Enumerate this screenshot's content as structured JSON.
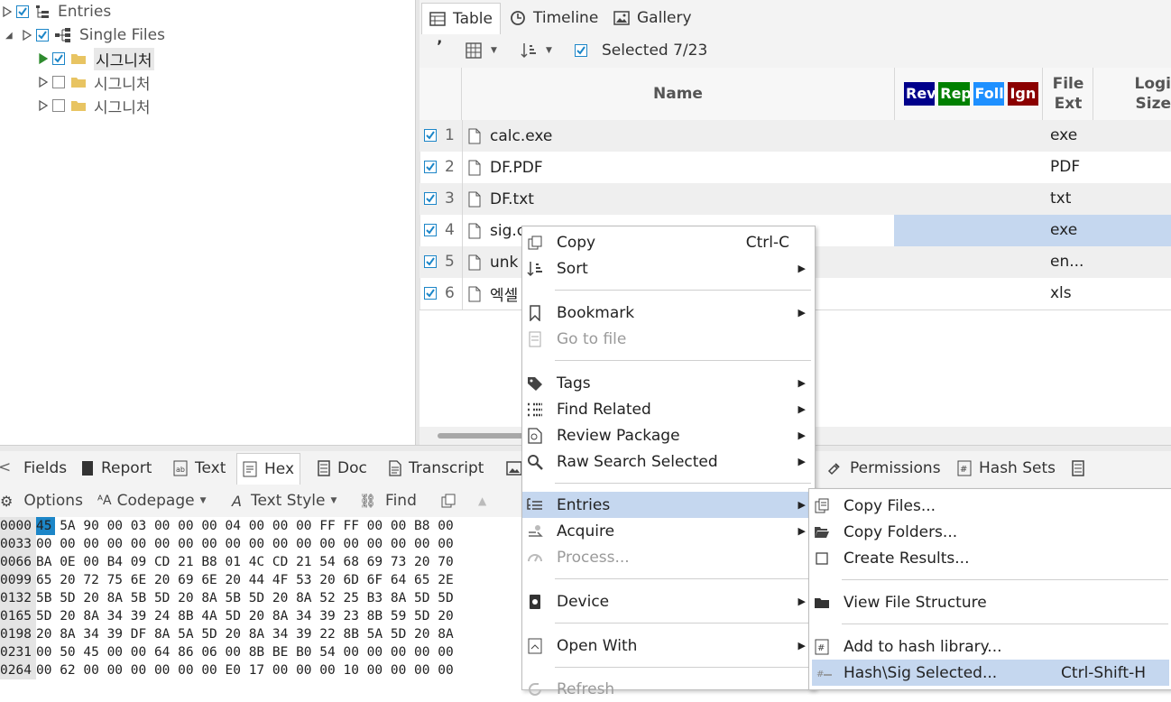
{
  "tree": {
    "root": "Entries",
    "single_files": "Single Files",
    "items": [
      "시그니처",
      "시그니처",
      "시그니처"
    ]
  },
  "view_tabs": {
    "table": "Table",
    "timeline": "Timeline",
    "gallery": "Gallery"
  },
  "toolbar": {
    "selected": "Selected 7/23",
    "quote_glyph": "’"
  },
  "columns": {
    "name": "Name",
    "tag_chips": [
      {
        "label": "Rev",
        "color": "#00008b"
      },
      {
        "label": "Rep",
        "color": "#008000"
      },
      {
        "label": "Foll",
        "color": "#1e90ff"
      },
      {
        "label": "Ign",
        "color": "#8b0000"
      }
    ],
    "file_ext_line1": "File",
    "file_ext_line2": "Ext",
    "logical_size_line1": "Logi",
    "logical_size_line2": "Size"
  },
  "rows": [
    {
      "num": "1",
      "name": "calc.exe",
      "ext": "exe"
    },
    {
      "num": "2",
      "name": "DF.PDF",
      "ext": "PDF"
    },
    {
      "num": "3",
      "name": "DF.txt",
      "ext": "txt"
    },
    {
      "num": "4",
      "name": "sig.c",
      "ext": "exe"
    },
    {
      "num": "5",
      "name": "unk",
      "ext": "en..."
    },
    {
      "num": "6",
      "name": "엑셀",
      "ext": "xls"
    }
  ],
  "bottom_tabs": {
    "fields": "Fields",
    "report": "Report",
    "text": "Text",
    "hex": "Hex",
    "doc": "Doc",
    "transcript": "Transcript",
    "permissions": "Permissions",
    "hash_sets": "Hash Sets"
  },
  "hex_toolbar": {
    "options": "Options",
    "codepage": "Codepage",
    "text_style": "Text Style",
    "find": "Find"
  },
  "hex_rows": [
    {
      "off": "0000",
      "bytes": "45 5A 90 00 03 00 00 00 04 00 00 00 FF FF 00 00 B8 00"
    },
    {
      "off": "0033",
      "bytes": "00 00 00 00 00 00 00 00 00 00 00 00 00 00 00 00 00 00"
    },
    {
      "off": "0066",
      "bytes": "BA 0E 00 B4 09 CD 21 B8 01 4C CD 21 54 68 69 73 20 70"
    },
    {
      "off": "0099",
      "bytes": "65 20 72 75 6E 20 69 6E 20 44 4F 53 20 6D 6F 64 65 2E"
    },
    {
      "off": "0132",
      "bytes": "5B 5D 20 8A 5B 5D 20 8A 5B 5D 20 8A 52 25 B3 8A 5D 5D"
    },
    {
      "off": "0165",
      "bytes": "5D 20 8A 34 39 24 8B 4A 5D 20 8A 34 39 23 8B 59 5D 20"
    },
    {
      "off": "0198",
      "bytes": "20 8A 34 39 DF 8A 5A 5D 20 8A 34 39 22 8B 5A 5D 20 8A"
    },
    {
      "off": "0231",
      "bytes": "00 50 45 00 00 64 86 06 00 8B BE B0 54 00 00 00 00 00"
    },
    {
      "off": "0264",
      "bytes": "00 62 00 00 00 00 00 00 E0 17 00 00 00 10 00 00 00 00"
    }
  ],
  "context_menu": {
    "copy": "Copy",
    "copy_shortcut": "Ctrl-C",
    "sort": "Sort",
    "bookmark": "Bookmark",
    "go_to_file": "Go to file",
    "tags": "Tags",
    "find_related": "Find Related",
    "review_package": "Review Package",
    "raw_search_selected": "Raw Search Selected",
    "entries": "Entries",
    "acquire": "Acquire",
    "process": "Process...",
    "device": "Device",
    "open_with": "Open With",
    "refresh": "Refresh"
  },
  "entries_submenu": {
    "copy_files": "Copy Files...",
    "copy_folders": "Copy Folders...",
    "create_results": "Create Results...",
    "view_file_structure": "View File Structure",
    "add_to_hash_library": "Add to hash library...",
    "hash_sig_selected": "Hash\\Sig Selected...",
    "hash_sig_shortcut": "Ctrl-Shift-H"
  },
  "colors": {
    "accent_check": "#1c86c8",
    "highlight": "#c5d7ef",
    "folder": "#e8c462"
  }
}
